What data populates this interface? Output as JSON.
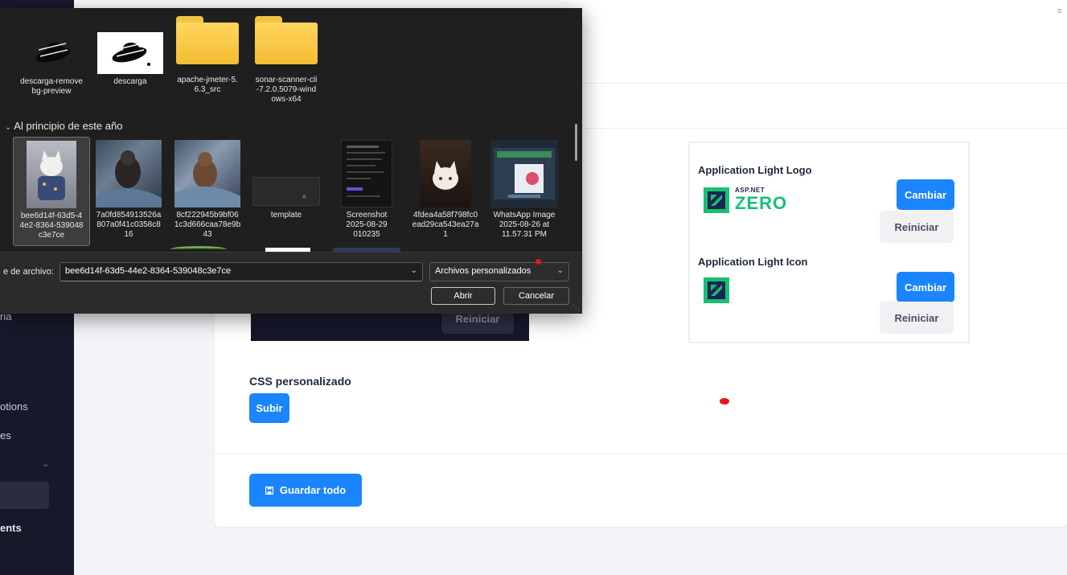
{
  "sidebar": {
    "items": [
      {
        "label": "ria"
      },
      {
        "label": "otions"
      },
      {
        "label": "es"
      },
      {
        "label": "ents"
      }
    ]
  },
  "dark_section": {
    "reset_label": "Reiniciar"
  },
  "logo_panel": {
    "light_logo": {
      "title": "Application Light Logo",
      "change_label": "Cambiar",
      "reset_label": "Reiniciar",
      "logo_small_text": "ASP.NET",
      "logo_big_text": "ZERO"
    },
    "light_icon": {
      "title": "Application Light Icon",
      "change_label": "Cambiar",
      "reset_label": "Reiniciar"
    }
  },
  "custom_css": {
    "title": "CSS personalizado",
    "upload_label": "Subir"
  },
  "footer": {
    "save_all_label": "Guardar todo"
  },
  "file_dialog": {
    "top_tiles": [
      {
        "name": "descarga-remove\nbg-preview"
      },
      {
        "name": "descarga"
      },
      {
        "name": "apache-jmeter-5.\n6.3_src"
      },
      {
        "name": "sonar-scanner-cli\n-7.2.0.5079-wind\nows-x64"
      }
    ],
    "group_header": "Al principio de este año",
    "group_tiles": [
      {
        "name": "bee6d14f-63d5-4\n4e2-8364-539048\nc3e7ce"
      },
      {
        "name": "7a0fd854913526a\n807a0f41c0358c8\n16"
      },
      {
        "name": "8cf222945b9bf06\n1c3d666caa78e9b\n43"
      },
      {
        "name": "template"
      },
      {
        "name": "Screenshot\n2025-08-29\n010235"
      },
      {
        "name": "4fdea4a58f798fc0\nead29ca543ea27a\n1"
      },
      {
        "name": "WhatsApp Image\n2025-08-26 at\n11.57.31 PM"
      }
    ],
    "filename_label": "e de archivo:",
    "filename_value": "bee6d14f-63d5-44e2-8364-539048c3e7ce",
    "filetype_value": "Archivos personalizados",
    "open_label": "Abrir",
    "cancel_label": "Cancelar"
  },
  "colors": {
    "primary": "#1b84ff",
    "sidebar_bg": "#17182a",
    "dialog_bg": "#1f1f1f",
    "folder_yellow": "#ffd65e",
    "zero_green": "#16c172",
    "zero_navy": "#1b2452"
  }
}
